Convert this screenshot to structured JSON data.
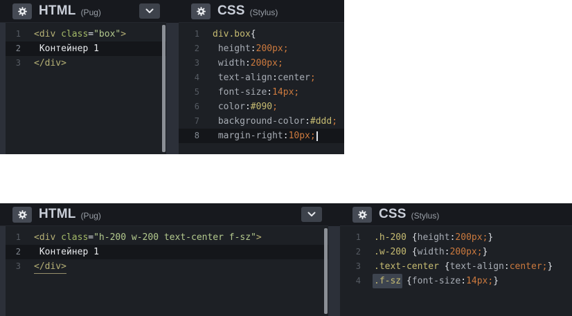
{
  "colors": {
    "page_bg": "#ffffff",
    "editor_bg": "#1d2025",
    "header_bg": "#17191e",
    "gutter": "#2c3039",
    "active_line_bg": "#14161a",
    "scrollbar_thumb": "#8b8f96",
    "tag_yellow": "#b6b176",
    "selector_yellow": "#c7bc72",
    "string_green": "#b4ca8e",
    "value_orange": "#cd7a3e",
    "property_gray": "#a8adb5",
    "text_white": "#e9ebee"
  },
  "sections": [
    {
      "name": "top",
      "panels": [
        {
          "header": {
            "title": "HTML",
            "syntax": "(Pug)",
            "gear_icon": "gear",
            "chevron_icon": "chevron-down"
          },
          "lines": [
            {
              "n": "1",
              "tokens": [
                [
                  "tag",
                  "<div "
                ],
                [
                  "attr",
                  "class"
                ],
                [
                  "punc",
                  "="
                ],
                [
                  "str",
                  "\"box\""
                ],
                [
                  "tag",
                  ">"
                ]
              ]
            },
            {
              "n": "2",
              "active": true,
              "tokens": [
                [
                  "plain",
                  " Контейнер 1"
                ]
              ]
            },
            {
              "n": "3",
              "tokens": [
                [
                  "tag",
                  "</div>"
                ]
              ]
            }
          ]
        },
        {
          "header": {
            "title": "CSS",
            "syntax": "(Stylus)",
            "gear_icon": "gear"
          },
          "lines": [
            {
              "n": "1",
              "tokens": [
                [
                  "sel",
                  "div.box"
                ],
                [
                  "punc",
                  "{"
                ]
              ]
            },
            {
              "n": "2",
              "tokens": [
                [
                  "prop",
                  " height"
                ],
                [
                  "punc",
                  ":"
                ],
                [
                  "num",
                  "200px"
                ],
                [
                  "num",
                  ";"
                ]
              ]
            },
            {
              "n": "3",
              "tokens": [
                [
                  "prop",
                  " width"
                ],
                [
                  "punc",
                  ":"
                ],
                [
                  "num",
                  "200px"
                ],
                [
                  "num",
                  ";"
                ]
              ]
            },
            {
              "n": "4",
              "tokens": [
                [
                  "prop",
                  " text-align"
                ],
                [
                  "punc",
                  ":"
                ],
                [
                  "valgray",
                  "center"
                ],
                [
                  "num",
                  ";"
                ]
              ]
            },
            {
              "n": "5",
              "tokens": [
                [
                  "prop",
                  " font-size"
                ],
                [
                  "punc",
                  ":"
                ],
                [
                  "num",
                  "14px"
                ],
                [
                  "num",
                  ";"
                ]
              ]
            },
            {
              "n": "6",
              "tokens": [
                [
                  "prop",
                  " color"
                ],
                [
                  "punc",
                  ":"
                ],
                [
                  "hex",
                  "#090"
                ],
                [
                  "num",
                  ";"
                ]
              ]
            },
            {
              "n": "7",
              "tokens": [
                [
                  "prop",
                  " background-color"
                ],
                [
                  "punc",
                  ":"
                ],
                [
                  "hex",
                  "#ddd"
                ],
                [
                  "num",
                  ";"
                ]
              ]
            },
            {
              "n": "8",
              "active": true,
              "caret": true,
              "tokens": [
                [
                  "prop",
                  " margin-right"
                ],
                [
                  "punc",
                  ":"
                ],
                [
                  "num",
                  "10px"
                ],
                [
                  "num",
                  ";"
                ]
              ]
            }
          ]
        }
      ]
    },
    {
      "name": "bottom",
      "panels": [
        {
          "header": {
            "title": "HTML",
            "syntax": "(Pug)",
            "gear_icon": "gear",
            "chevron_icon": "chevron-down"
          },
          "lines": [
            {
              "n": "1",
              "tokens": [
                [
                  "tag",
                  "<div "
                ],
                [
                  "attr",
                  "class"
                ],
                [
                  "punc",
                  "="
                ],
                [
                  "str",
                  "\"h-200 w-200 text-center f-sz\""
                ],
                [
                  "tag",
                  ">"
                ]
              ]
            },
            {
              "n": "2",
              "active": true,
              "tokens": [
                [
                  "plain",
                  " Контейнер 1"
                ]
              ]
            },
            {
              "n": "3",
              "tokens": [
                [
                  "tag",
                  "</div>",
                  "match"
                ]
              ]
            }
          ]
        },
        {
          "header": {
            "title": "CSS",
            "syntax": "(Stylus)",
            "gear_icon": "gear"
          },
          "lines": [
            {
              "n": "1",
              "tokens": [
                [
                  "sel",
                  ".h-200"
                ],
                [
                  "punc",
                  " {"
                ],
                [
                  "prop",
                  "height"
                ],
                [
                  "punc",
                  ":"
                ],
                [
                  "num",
                  "200px"
                ],
                [
                  "num",
                  ";"
                ],
                [
                  "punc",
                  "}"
                ]
              ]
            },
            {
              "n": "2",
              "tokens": [
                [
                  "sel",
                  ".w-200"
                ],
                [
                  "punc",
                  " {"
                ],
                [
                  "prop",
                  "width"
                ],
                [
                  "punc",
                  ":"
                ],
                [
                  "num",
                  "200px"
                ],
                [
                  "num",
                  ";"
                ],
                [
                  "punc",
                  "}"
                ]
              ]
            },
            {
              "n": "3",
              "tokens": [
                [
                  "sel",
                  ".text-center"
                ],
                [
                  "punc",
                  " {"
                ],
                [
                  "prop",
                  "text-align"
                ],
                [
                  "punc",
                  ":"
                ],
                [
                  "num",
                  "center"
                ],
                [
                  "num",
                  ";"
                ],
                [
                  "punc",
                  "}"
                ]
              ]
            },
            {
              "n": "4",
              "tokens": [
                [
                  "sel",
                  ".f-sz",
                  "selected"
                ],
                [
                  "punc",
                  " {"
                ],
                [
                  "prop",
                  "font-size"
                ],
                [
                  "punc",
                  ":"
                ],
                [
                  "num",
                  "14px"
                ],
                [
                  "num",
                  ";"
                ],
                [
                  "punc",
                  "}"
                ]
              ]
            }
          ]
        }
      ]
    }
  ]
}
